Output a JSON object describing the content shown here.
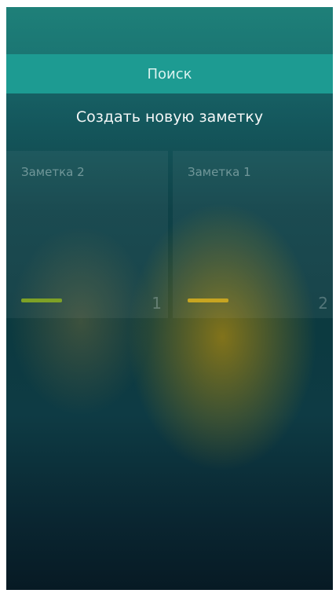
{
  "search": {
    "label": "Поиск"
  },
  "create_note": {
    "label": "Создать новую заметку"
  },
  "notes": [
    {
      "title": "Заметка 2",
      "number": "1",
      "color": "#7ea126"
    },
    {
      "title": "Заметка 1",
      "number": "2",
      "color": "#c7a521"
    }
  ],
  "colors": {
    "accent": "#1d9b92",
    "topbar": "#1e8079"
  }
}
